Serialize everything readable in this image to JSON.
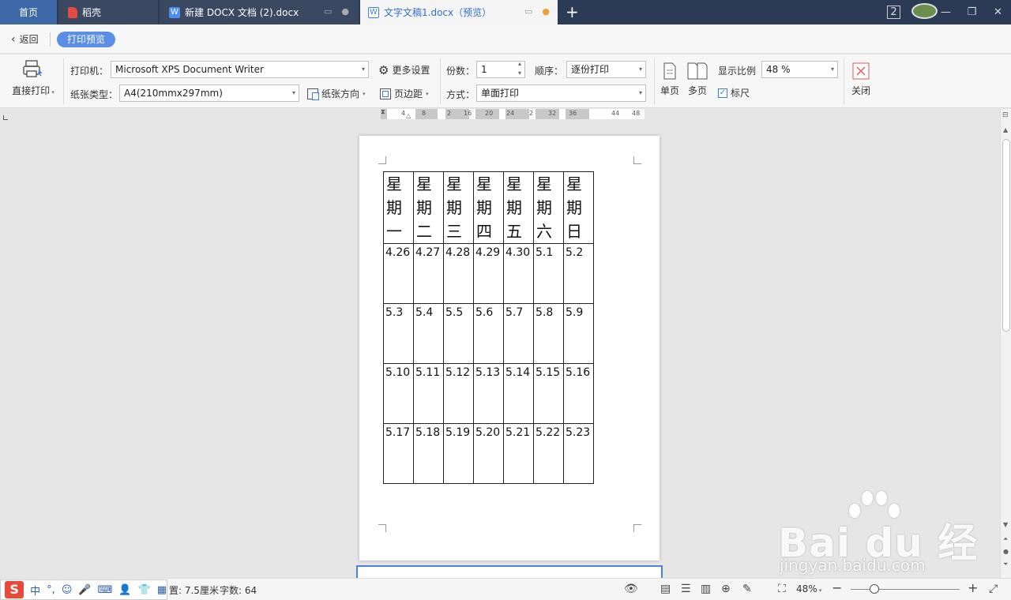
{
  "tabs": {
    "home": "首页",
    "daoke": "稻壳",
    "doc1": "新建 DOCX 文档 (2).docx",
    "doc2": "文字文稿1.docx（预览）",
    "window_count": "2"
  },
  "preview_bar": {
    "back_label": "返回",
    "mode_label": "打印预览"
  },
  "ribbon": {
    "direct_print": "直接打印",
    "printer_label": "打印机：",
    "printer_value": "Microsoft XPS Document Writer",
    "more_settings": "更多设置",
    "paper_type_label": "纸张类型：",
    "paper_type_value": "A4(210mmx297mm)",
    "orientation": "纸张方向",
    "margins": "页边距",
    "copies_label": "份数：",
    "copies_value": "1",
    "order_label": "顺序：",
    "order_value": "逐份打印",
    "mode_label": "方式：",
    "mode_value": "单面打印",
    "single_page": "单页",
    "multi_page": "多页",
    "zoom_label": "显示比例",
    "zoom_value": "48 %",
    "ruler_checkbox": "标尺",
    "close": "关闭"
  },
  "ruler": {
    "ticks": [
      "4",
      "8",
      "2",
      "16",
      "20",
      "24",
      "2",
      "32",
      "36",
      "44",
      "48"
    ]
  },
  "calendar": {
    "headers": [
      "星期一",
      "星期二",
      "星期三",
      "星期四",
      "星期五",
      "星期六",
      "星期日"
    ],
    "rows": [
      [
        "4.26",
        "4.27",
        "4.28",
        "4.29",
        "4.30",
        "5.1",
        "5.2"
      ],
      [
        "5.3",
        "5.4",
        "5.5",
        "5.6",
        "5.7",
        "5.8",
        "5.9"
      ],
      [
        "5.10",
        "5.11",
        "5.12",
        "5.13",
        "5.14",
        "5.15",
        "5.16"
      ],
      [
        "5.17",
        "5.18",
        "5.19",
        "5.20",
        "5.21",
        "5.22",
        "5.23"
      ]
    ]
  },
  "status": {
    "position": "置: 7.5厘米",
    "word_count": "字数: 64",
    "zoom": "48%"
  },
  "ime": {
    "logo": "S",
    "lang": "中"
  },
  "watermark": {
    "main": "Bai du 经验",
    "sub": "jingyan.baidu.com"
  }
}
